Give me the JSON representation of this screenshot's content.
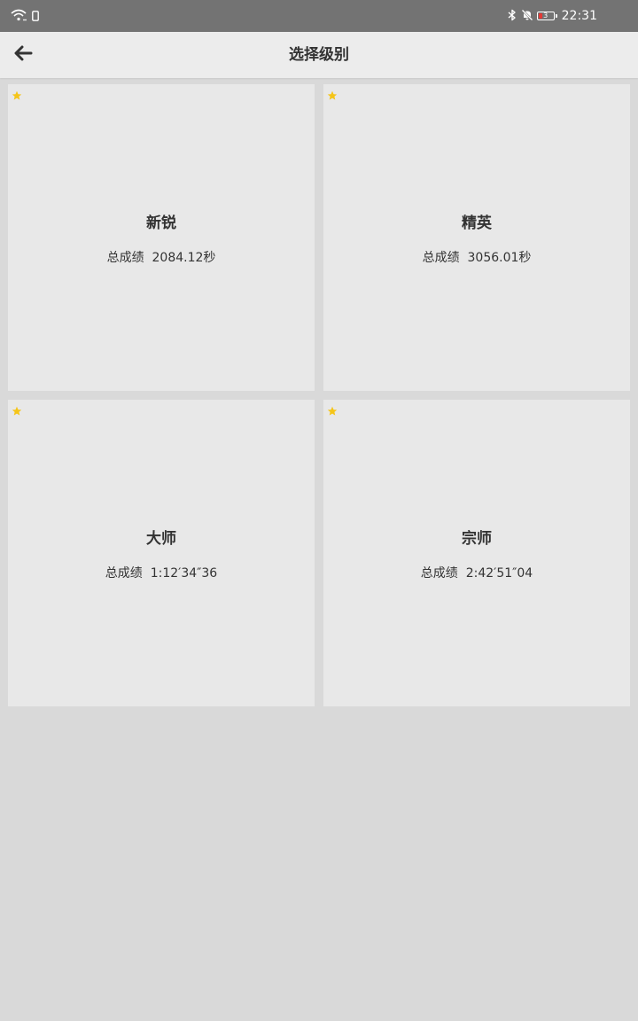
{
  "status_bar": {
    "time": "22:31",
    "battery_level": "3",
    "icons": [
      "wifi-icon",
      "phone-icon",
      "bluetooth-icon",
      "bell-muted-icon",
      "battery-icon"
    ]
  },
  "app_bar": {
    "title": "选择级别",
    "back_icon": "arrow-left-icon"
  },
  "colors": {
    "star": "#f5c518",
    "status_bar_bg": "#737373",
    "background": "#d9d9d9",
    "card_bg": "#e8e8e8"
  },
  "levels": [
    {
      "title": "新锐",
      "score_label": "总成绩",
      "score": "2084.12秒",
      "starred": true
    },
    {
      "title": "精英",
      "score_label": "总成绩",
      "score": "3056.01秒",
      "starred": true
    },
    {
      "title": "大师",
      "score_label": "总成绩",
      "score": "1:12′34″36",
      "starred": true
    },
    {
      "title": "宗师",
      "score_label": "总成绩",
      "score": "2:42′51″04",
      "starred": true
    }
  ]
}
